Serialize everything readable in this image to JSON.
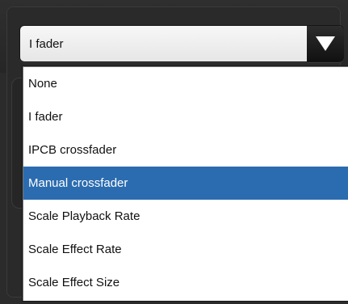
{
  "dropdown": {
    "value": "I fader",
    "arrow_icon": "triangle-down-icon",
    "options": [
      {
        "label": "None"
      },
      {
        "label": "I fader"
      },
      {
        "label": "IPCB crossfader"
      },
      {
        "label": "Manual crossfader"
      },
      {
        "label": "Scale Playback Rate"
      },
      {
        "label": "Scale Effect Rate"
      },
      {
        "label": "Scale Effect Size"
      }
    ],
    "highlighted_option": "Manual crossfader"
  },
  "colors": {
    "highlight": "#2b6cb0",
    "background": "#2b2b2b"
  }
}
